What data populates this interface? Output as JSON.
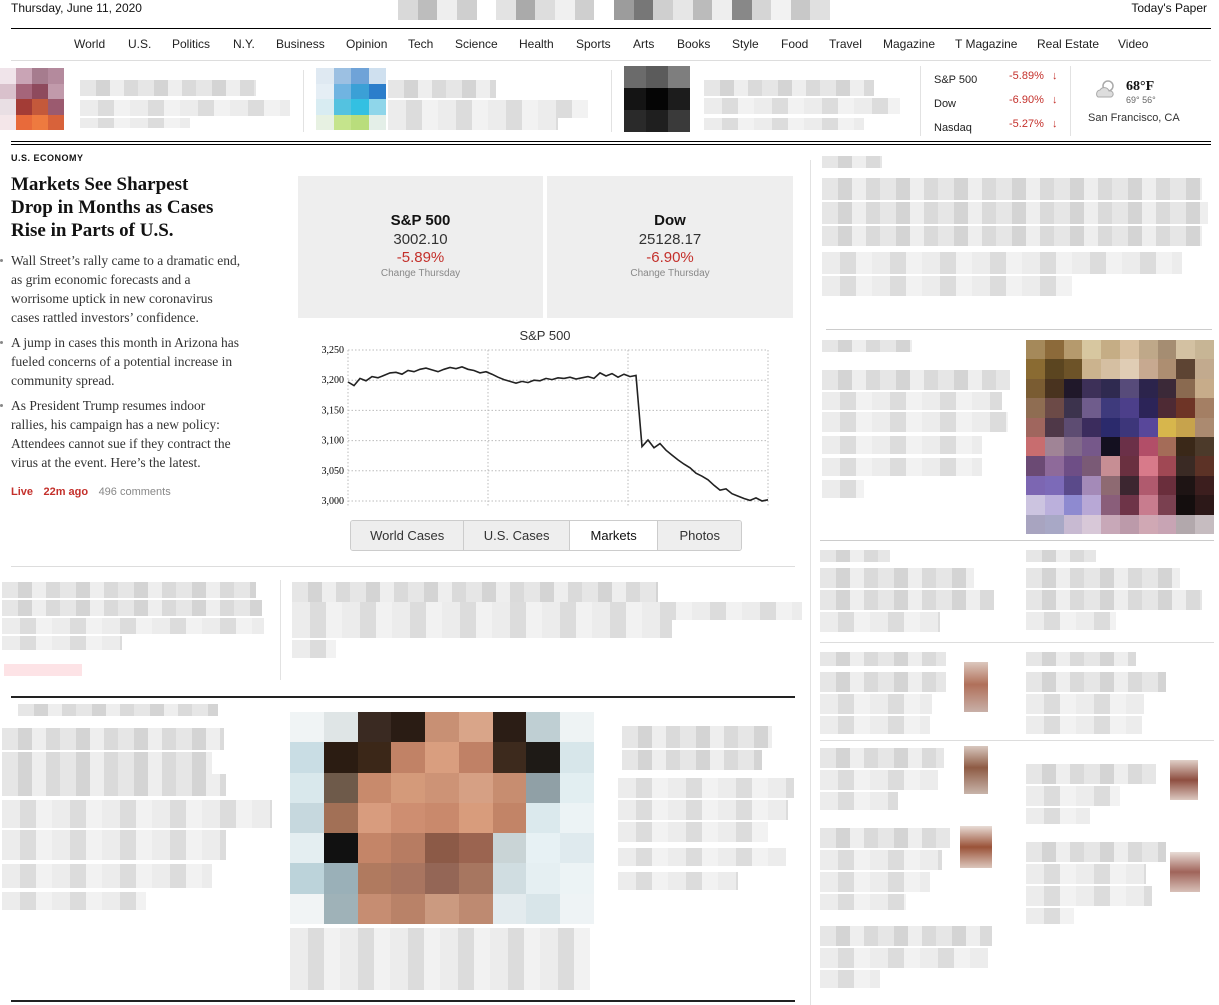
{
  "header": {
    "date": "Thursday, June 11, 2020",
    "todays_paper": "Today's Paper"
  },
  "nav": {
    "items": [
      "World",
      "U.S.",
      "Politics",
      "N.Y.",
      "Business",
      "Opinion",
      "Tech",
      "Science",
      "Health",
      "Sports",
      "Arts",
      "Books",
      "Style",
      "Food",
      "Travel",
      "Magazine",
      "T Magazine",
      "Real Estate",
      "Video"
    ]
  },
  "markets_ticker": [
    {
      "name": "S&P 500",
      "change": "-5.89%"
    },
    {
      "name": "Dow",
      "change": "-6.90%"
    },
    {
      "name": "Nasdaq",
      "change": "-5.27%"
    }
  ],
  "weather": {
    "temp": "68°F",
    "hi_lo": "69° 56°",
    "location": "San Francisco, CA",
    "icon": "partly-cloudy-icon"
  },
  "lead_story": {
    "kicker": "U.S. ECONOMY",
    "headline_lines": [
      "Markets See Sharpest",
      "Drop in Months as Cases",
      "Rise in Parts of U.S."
    ],
    "bullets": [
      [
        "Wall Street’s rally came to a dramatic end,",
        "as grim economic forecasts and a",
        "worrisome uptick in new coronavirus",
        "cases rattled investors’ confidence."
      ],
      [
        "A jump in cases this month in Arizona has",
        "fueled concerns of a potential increase in",
        "community spread."
      ],
      [
        "As President Trump resumes indoor",
        "rallies, his campaign has a new policy:",
        "Attendees cannot sue if they contract the",
        "virus at the event. Here’s the latest."
      ]
    ],
    "live_label": "Live",
    "time_ago": "22m ago",
    "comments": "496 comments"
  },
  "stock_boxes": [
    {
      "name": "S&P 500",
      "value": "3002.10",
      "change": "-5.89%",
      "note": "Change Thursday"
    },
    {
      "name": "Dow",
      "value": "25128.17",
      "change": "-6.90%",
      "note": "Change Thursday"
    }
  ],
  "tabs": [
    "World Cases",
    "U.S. Cases",
    "Markets",
    "Photos"
  ],
  "active_tab": "Markets",
  "chart_data": {
    "type": "line",
    "title": "S&P 500",
    "ylim": [
      2990,
      3250
    ],
    "yticks": [
      "3,250",
      "3,200",
      "3,150",
      "3,100",
      "3,050",
      "3,000"
    ],
    "ytick_values": [
      3250,
      3200,
      3150,
      3100,
      3050,
      3000
    ],
    "grid": true,
    "series": [
      {
        "values": [
          3197,
          3191,
          3203,
          3199,
          3206,
          3204,
          3208,
          3212,
          3213,
          3210,
          3216,
          3214,
          3218,
          3220,
          3217,
          3214,
          3218,
          3221,
          3219,
          3222,
          3218,
          3216,
          3212,
          3214,
          3210,
          3205,
          3201,
          3198,
          3195,
          3198,
          3196,
          3200,
          3199,
          3203,
          3201,
          3204,
          3203,
          3205,
          3202,
          3204,
          3206,
          3203,
          3212,
          3207,
          3211,
          3205,
          3210,
          3206,
          3208,
          3090,
          3101,
          3088,
          3095,
          3084,
          3076,
          3068,
          3061,
          3055,
          3046,
          3041,
          3035,
          3026,
          3018,
          3020,
          3012,
          3008,
          3004,
          3001,
          3005,
          3000,
          3002
        ]
      }
    ]
  }
}
